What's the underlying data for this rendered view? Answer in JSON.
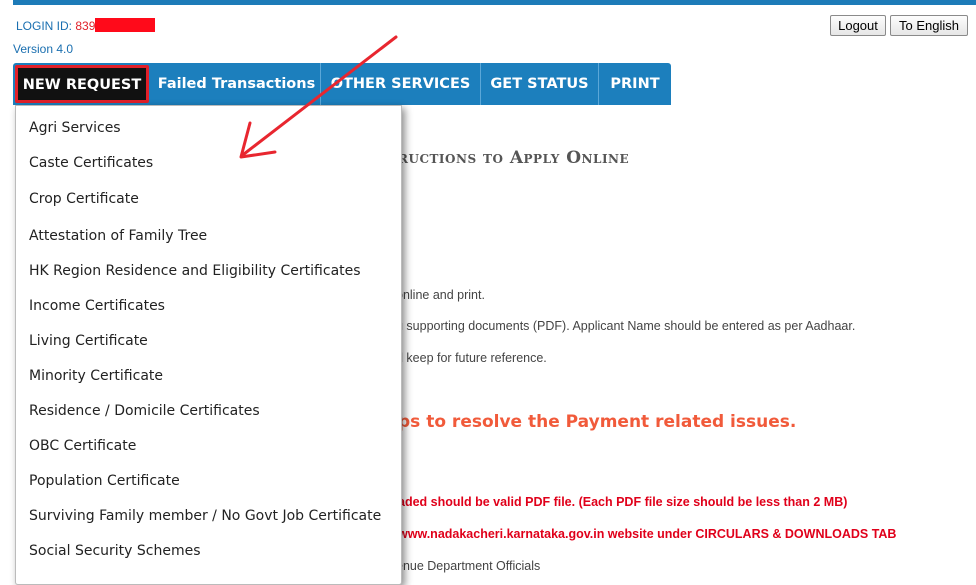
{
  "header": {
    "login_label": "LOGIN ID:",
    "login_value_prefix": "839",
    "version": "Version 4.0",
    "logout_label": "Logout",
    "english_label": "To English"
  },
  "nav": {
    "items": [
      {
        "label": "NEW REQUEST"
      },
      {
        "label": "Failed Transactions"
      },
      {
        "label": "OTHER SERVICES"
      },
      {
        "label": "GET STATUS"
      },
      {
        "label": "PRINT"
      }
    ]
  },
  "dropdown": {
    "items": [
      "Agri Services",
      "Caste Certificates",
      "Crop Certificate",
      "Attestation of Family Tree",
      "HK Region Residence and Eligibility Certificates",
      "Income Certificates",
      "Living Certificate",
      "Minority Certificate",
      "Residence / Domicile Certificates",
      "OBC Certificate",
      "Population Certificate",
      "Surviving Family member / No Govt Job Certificate",
      "Social Security Schemes"
    ]
  },
  "content": {
    "title": "ructions to Apply Online",
    "line1": "online and print.",
    "line2": "g supporting documents (PDF). Applicant Name should be entered as per Aadhaar.",
    "line3": "d keep for future reference.",
    "payment_heading": "ps to resolve the Payment related issues.",
    "red1": "aded should be valid PDF file. (Each PDF file size should be less than 2 MB)",
    "red2": "www.nadakacheri.karnataka.gov.in website under CIRCULARS & DOWNLOADS TAB",
    "line4": "enue Department Officials"
  },
  "colors": {
    "nav_bg": "#1c7fbd",
    "highlight": "#e0202a",
    "payment_heading": "#f15a3a",
    "warning_text": "#e0001a"
  }
}
